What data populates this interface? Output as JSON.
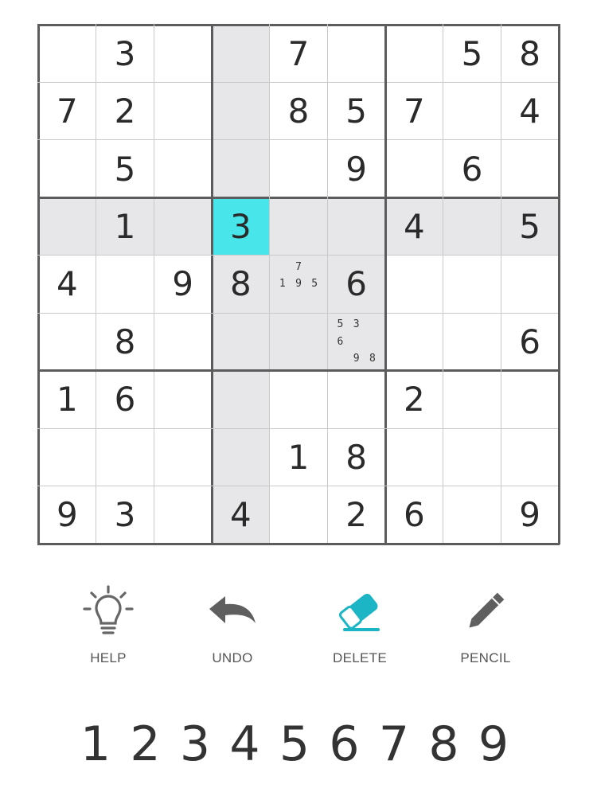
{
  "board": {
    "rows": [
      [
        "",
        "3",
        "",
        "",
        "7",
        "",
        "",
        "5",
        "8"
      ],
      [
        "7",
        "2",
        "",
        "",
        "8",
        "5",
        "7",
        "",
        "4"
      ],
      [
        "",
        "5",
        "",
        "",
        "",
        "9",
        "",
        "6",
        ""
      ],
      [
        "",
        "1",
        "",
        "3",
        "",
        "",
        "4",
        "",
        "5"
      ],
      [
        "4",
        "",
        "9",
        "8",
        "",
        "6",
        "",
        "",
        ""
      ],
      [
        "",
        "8",
        "",
        "",
        "",
        "",
        "",
        "",
        "6"
      ],
      [
        "1",
        "6",
        "",
        "",
        "",
        "",
        "2",
        "",
        ""
      ],
      [
        "",
        "",
        "",
        "",
        "1",
        "8",
        "",
        "",
        ""
      ],
      [
        "9",
        "3",
        "",
        "4",
        "",
        "2",
        "6",
        "",
        "9"
      ]
    ],
    "selected": {
      "row": 3,
      "col": 3
    },
    "highlight_color": "#48e6ea",
    "shade_color": "#e7e7e9",
    "notes": [
      {
        "row": 4,
        "col": 4,
        "candidates": [
          "",
          "7",
          "",
          "1",
          "9",
          "5",
          "",
          "",
          ""
        ]
      },
      {
        "row": 5,
        "col": 5,
        "candidates": [
          "5",
          "3",
          "",
          "6",
          "",
          "",
          "",
          "9",
          "8"
        ]
      }
    ]
  },
  "toolbar": {
    "help": {
      "label": "HELP",
      "icon": "lightbulb-icon"
    },
    "undo": {
      "label": "UNDO",
      "icon": "undo-arrow-icon"
    },
    "delete": {
      "label": "DELETE",
      "icon": "eraser-icon",
      "color": "#1bb5c6"
    },
    "pencil": {
      "label": "PENCIL",
      "icon": "pencil-icon"
    }
  },
  "numpad": [
    "1",
    "2",
    "3",
    "4",
    "5",
    "6",
    "7",
    "8",
    "9"
  ]
}
